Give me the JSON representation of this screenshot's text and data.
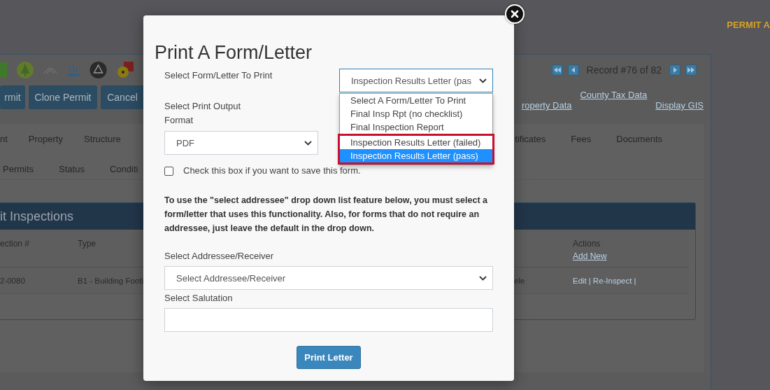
{
  "header": {
    "badge": "PERMIT A"
  },
  "toolbar": {
    "buttons": [
      "rmit",
      "Clone Permit",
      "Cancel"
    ]
  },
  "record_nav": {
    "label": "Record #76 of 82"
  },
  "links": [
    "roperty Data",
    "County Tax Data",
    "Display GIS"
  ],
  "tabs_row_1": {
    "left": [
      "nt",
      "Property",
      "Structure"
    ],
    "right": [
      "tificates",
      "Fees",
      "Documents"
    ]
  },
  "tabs_row_2": [
    "Permits",
    "Status",
    "Conditi"
  ],
  "inspections": {
    "title": "it Inspections",
    "columns": {
      "inspection_no": "ection #",
      "type": "Type",
      "actions": {
        "label": "Actions",
        "link": "Add New"
      }
    },
    "rows": [
      {
        "inspection_no": "2-0080",
        "type": "B1 - Building Footi",
        "column_3": "ele",
        "actions": [
          "Edit",
          "Re-Inspect"
        ],
        "separator": "|"
      }
    ]
  },
  "modal": {
    "title": "Print A Form/Letter",
    "form_select": {
      "label": "Select Form/Letter To Print",
      "value": "Inspection Results Letter (pas",
      "expanded": true,
      "options": [
        {
          "label": "Select A Form/Letter To Print",
          "selected": false,
          "flagged": false
        },
        {
          "label": "Final Insp Rpt (no checklist)",
          "selected": false,
          "flagged": false
        },
        {
          "label": "Final Inspection Report",
          "selected": false,
          "flagged": false
        },
        {
          "label": "Inspection Results Letter (failed)",
          "selected": false,
          "flagged": true
        },
        {
          "label": "Inspection Results Letter (pass)",
          "selected": true,
          "flagged": true
        }
      ]
    },
    "output_select": {
      "label": "Select Print Output Format",
      "value": "PDF"
    },
    "save_checkbox": {
      "label": "Check this box if you want to save this form.",
      "checked": false
    },
    "notice": "To use the \"select addressee\" drop down list feature below, you must select a form/letter that uses this functionality. Also, for forms that do not require an addressee, just leave the default in the drop down.",
    "addressee_select": {
      "label": "Select Addressee/Receiver",
      "value": "Select Addressee/Receiver"
    },
    "salutation": {
      "label": "Select Salutation"
    },
    "print_button": "Print Letter"
  }
}
